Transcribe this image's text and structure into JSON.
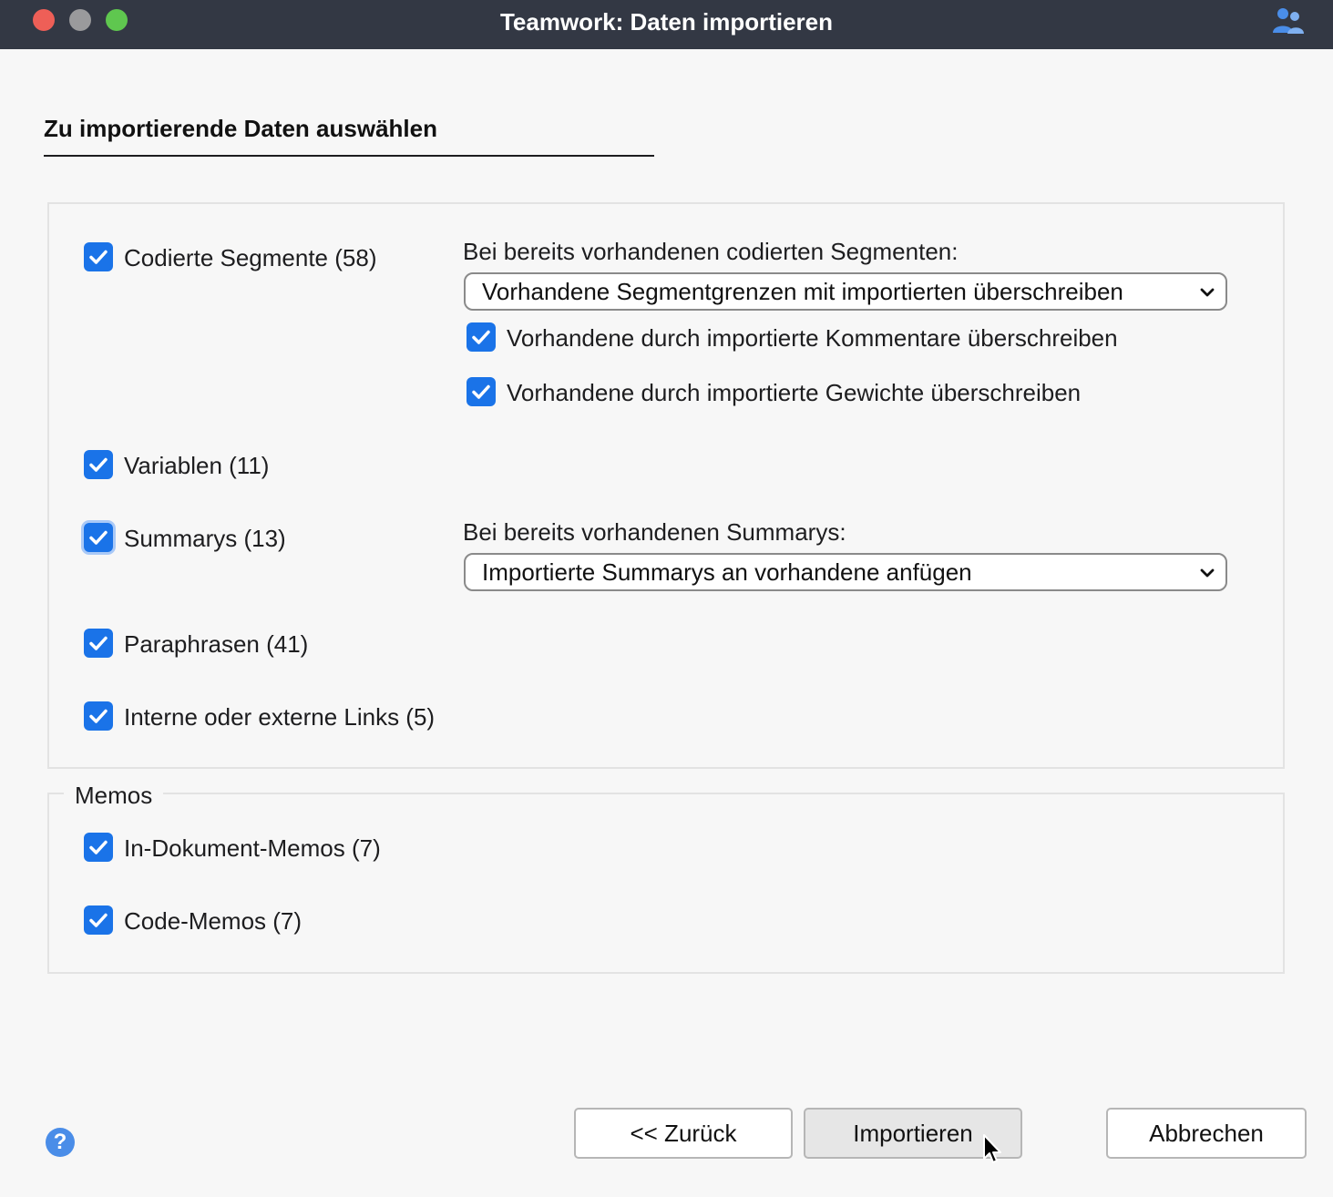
{
  "window": {
    "title": "Teamwork: Daten importieren",
    "team_icon": "people-icon"
  },
  "section": {
    "title": "Zu importierende Daten auswählen"
  },
  "items": {
    "segments": {
      "label": "Codierte Segmente (58)",
      "checked": true
    },
    "variables": {
      "label": "Variablen (11)",
      "checked": true
    },
    "summaries": {
      "label": "Summarys (13)",
      "checked": true
    },
    "paraphrases": {
      "label": "Paraphrasen (41)",
      "checked": true
    },
    "links": {
      "label": "Interne oder externe Links (5)",
      "checked": true
    }
  },
  "segment_options": {
    "heading": "Bei bereits vorhandenen codierten Segmenten:",
    "select_value": "Vorhandene Segmentgrenzen mit importierten überschreiben",
    "comments": {
      "label": "Vorhandene durch importierte Kommentare überschreiben",
      "checked": true
    },
    "weights": {
      "label": "Vorhandene durch importierte Gewichte überschreiben",
      "checked": true
    }
  },
  "summary_options": {
    "heading": "Bei bereits vorhandenen Summarys:",
    "select_value": "Importierte Summarys an vorhandene anfügen"
  },
  "memos": {
    "legend": "Memos",
    "in_document": {
      "label": "In-Dokument-Memos (7)",
      "checked": true
    },
    "code": {
      "label": "Code-Memos (7)",
      "checked": true
    }
  },
  "buttons": {
    "back": "<< Zurück",
    "import": "Importieren",
    "cancel": "Abbrechen"
  },
  "help": {
    "label": "?"
  },
  "colors": {
    "accent": "#1a73e8",
    "titlebar": "#333844"
  }
}
